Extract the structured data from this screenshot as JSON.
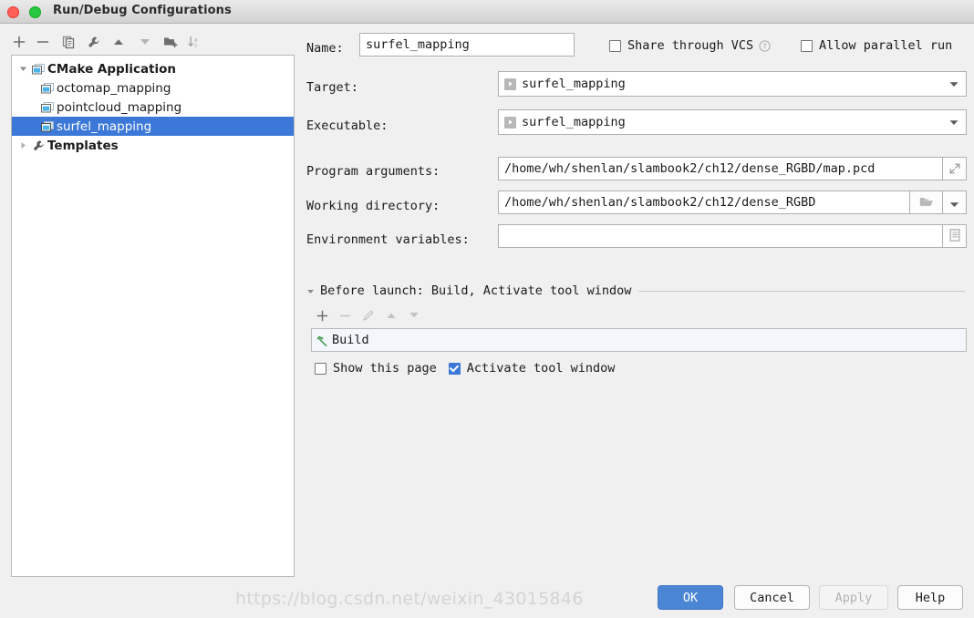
{
  "window": {
    "title": "Run/Debug Configurations",
    "close_button": "close",
    "zoom_button": "zoom"
  },
  "left_toolbar": {
    "buttons": [
      {
        "name": "add-configuration-button",
        "icon": "plus-icon",
        "tooltip": "Add New Configuration"
      },
      {
        "name": "remove-configuration-button",
        "icon": "minus-icon",
        "tooltip": "Remove Configuration"
      },
      {
        "name": "copy-configuration-button",
        "icon": "copy-icon",
        "tooltip": "Copy Configuration"
      },
      {
        "name": "edit-templates-button",
        "icon": "wrench-icon",
        "tooltip": "Edit Templates"
      },
      {
        "name": "move-up-button",
        "icon": "arrow-up-icon",
        "tooltip": "Move Up"
      },
      {
        "name": "move-down-button",
        "icon": "arrow-down-icon",
        "tooltip": "Move Down"
      },
      {
        "name": "move-into-folder-button",
        "icon": "folder-add-icon",
        "tooltip": "Create New Folder"
      },
      {
        "name": "sort-configurations-button",
        "icon": "sort-alpha-icon",
        "tooltip": "Sort Configurations"
      }
    ]
  },
  "tree": {
    "nodes": [
      {
        "label": "CMake Application",
        "level": 0,
        "expanded": true,
        "icon": "application-icon",
        "selected": false,
        "bold": true
      },
      {
        "label": "octomap_mapping",
        "level": 1,
        "expanded": null,
        "icon": "application-icon",
        "selected": false,
        "bold": false
      },
      {
        "label": "pointcloud_mapping",
        "level": 1,
        "expanded": null,
        "icon": "application-icon",
        "selected": false,
        "bold": false
      },
      {
        "label": "surfel_mapping",
        "level": 1,
        "expanded": null,
        "icon": "application-icon",
        "selected": true,
        "bold": false
      },
      {
        "label": "Templates",
        "level": 0,
        "expanded": false,
        "icon": "wrench-icon",
        "selected": false,
        "bold": true
      }
    ]
  },
  "form": {
    "name_label": "Name:",
    "name_value": "surfel_mapping",
    "share_vcs_label": "Share through VCS",
    "share_vcs_checked": false,
    "help_icon": "question-circle-icon",
    "allow_parallel_label": "Allow parallel run",
    "allow_parallel_checked": false,
    "target_label": "Target:",
    "target_value": "surfel_mapping",
    "executable_label": "Executable:",
    "executable_value": "surfel_mapping",
    "program_args_label": "Program arguments:",
    "program_args_value": "/home/wh/shenlan/slambook2/ch12/dense_RGBD/map.pcd",
    "program_args_expand_icon": "expand-icon",
    "working_dir_label": "Working directory:",
    "working_dir_value": "/home/wh/shenlan/slambook2/ch12/dense_RGBD",
    "working_dir_browse_icon": "folder-open-icon",
    "working_dir_history_icon": "chevron-down-icon",
    "env_vars_label": "Environment variables:",
    "env_vars_value": "",
    "env_vars_icon": "list-document-icon"
  },
  "before_launch": {
    "header": "Before launch: Build, Activate tool window",
    "collapse_icon": "triangle-down-icon",
    "toolbar": [
      {
        "name": "add-task-button",
        "icon": "plus-icon"
      },
      {
        "name": "remove-task-button",
        "icon": "minus-icon"
      },
      {
        "name": "edit-task-button",
        "icon": "pencil-icon"
      },
      {
        "name": "task-move-up-button",
        "icon": "arrow-up-icon"
      },
      {
        "name": "task-move-down-button",
        "icon": "arrow-down-icon"
      }
    ],
    "tasks": [
      {
        "label": "Build",
        "icon": "hammer-icon"
      }
    ],
    "show_page_label": "Show this page",
    "show_page_checked": false,
    "activate_window_label": "Activate tool window",
    "activate_window_checked": true
  },
  "buttons": {
    "ok": "OK",
    "cancel": "Cancel",
    "apply": "Apply",
    "apply_disabled": true,
    "help": "Help"
  },
  "watermark": "https://blog.csdn.net/weixin_43015846",
  "colors": {
    "selection_blue": "#3b78d8",
    "primary_button": "#4a86d4",
    "window_bg": "#f0f0f0",
    "panel_bg": "#ffffff",
    "build_icon_green": "#4f9e57"
  }
}
